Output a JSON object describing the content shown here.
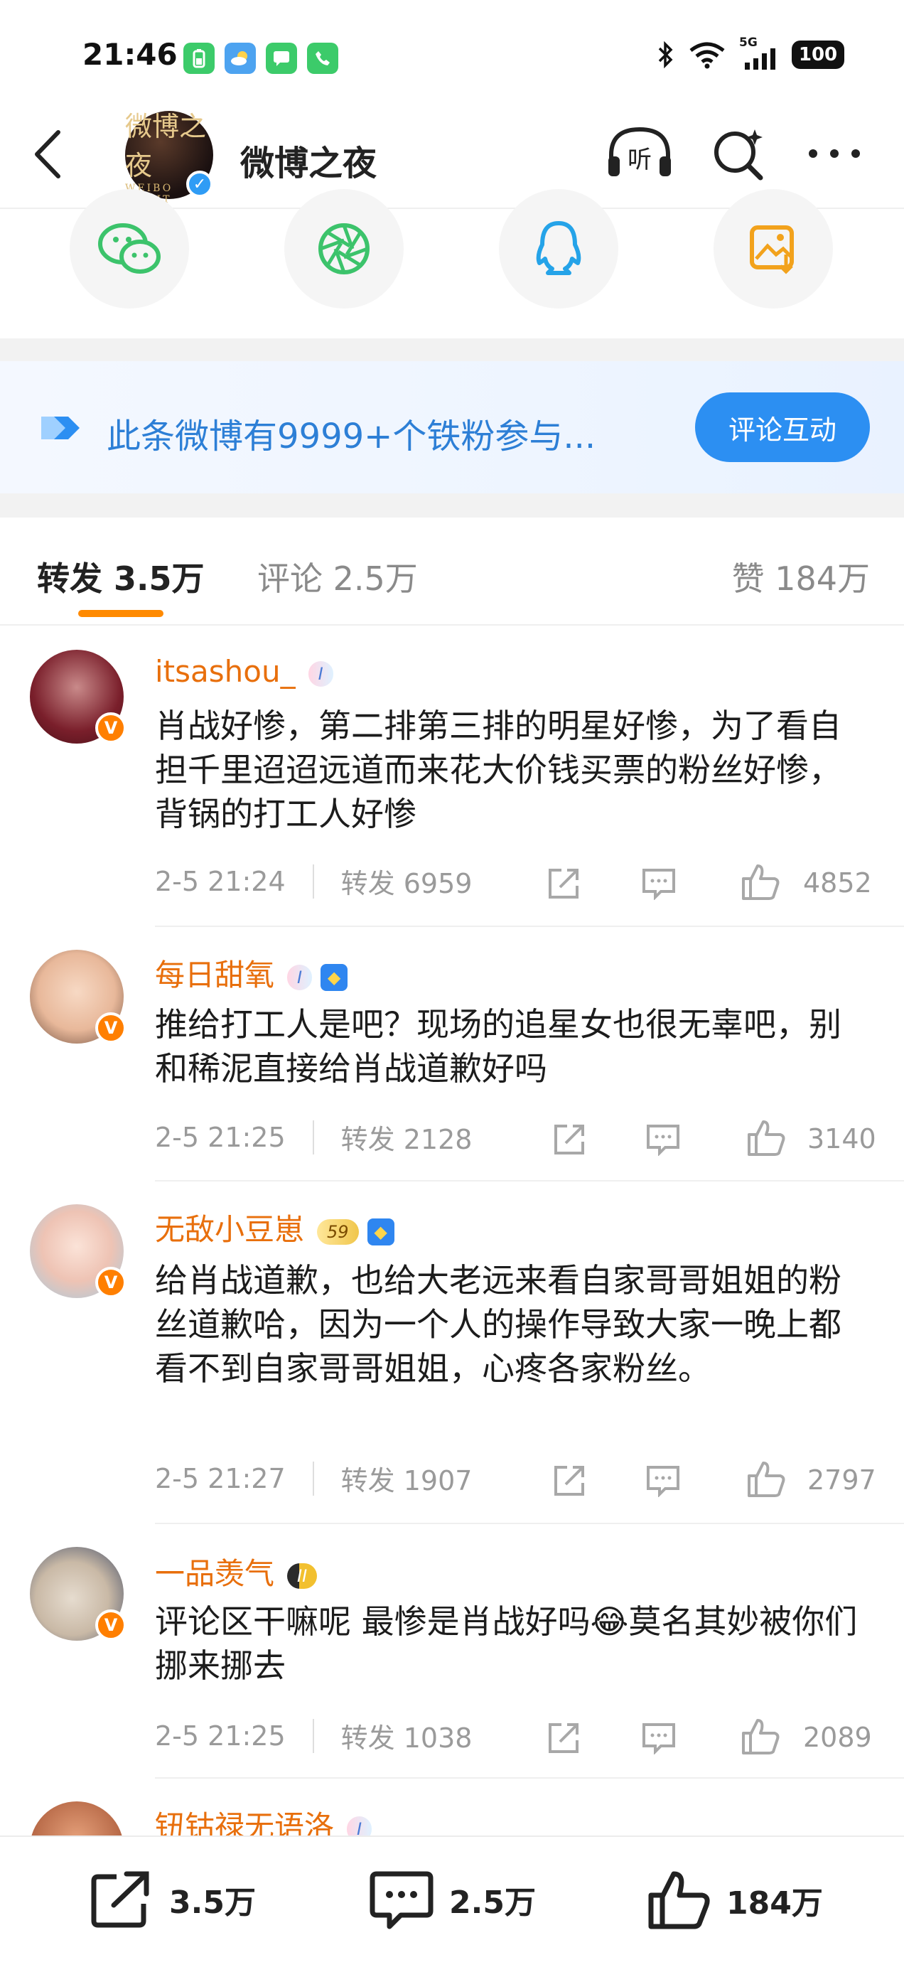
{
  "status": {
    "time": "21:46",
    "battery": "100",
    "network": "5G"
  },
  "header": {
    "title": "微博之夜",
    "avatar_lines": [
      "微博之夜",
      "WEIBO NIGHT"
    ]
  },
  "banner": {
    "text": "此条微博有9999+个铁粉参与...",
    "button": "评论互动"
  },
  "tabs": {
    "repost": "转发 3.5万",
    "comment": "评论 2.5万",
    "like": "赞 184万"
  },
  "comments": [
    {
      "name": "itsashou_",
      "level": "I",
      "text": "肖战好惨，第二排第三排的明星好惨，为了看自担千里迢迢远道而来花大价钱买票的粉丝好惨，背锅的打工人好惨",
      "time": "2-5 21:24",
      "reposts": "转发 6959",
      "likes": "4852"
    },
    {
      "name": "每日甜氧",
      "level": "I",
      "text": "推给打工人是吧？现场的追星女也很无辜吧，别和稀泥直接给肖战道歉好吗",
      "time": "2-5 21:25",
      "reposts": "转发 2128",
      "likes": "3140"
    },
    {
      "name": "无敌小豆崽",
      "level": "59",
      "text": "给肖战道歉，也给大老远来看自家哥哥姐姐的粉丝道歉哈，因为一个人的操作导致大家一晚上都看不到自家哥哥姐姐，心疼各家粉丝。",
      "time": "2-5 21:27",
      "reposts": "转发 1907",
      "likes": "2797"
    },
    {
      "name": "一品羡气",
      "level": "II",
      "text": "评论区干嘛呢 最惨是肖战好吗😂莫名其妙被你们挪来挪去",
      "time": "2-5 21:25",
      "reposts": "转发 1038",
      "likes": "2089"
    },
    {
      "name": "钮钴禄无语洛",
      "level": "I"
    }
  ],
  "bottom": {
    "reposts": "3.5万",
    "comments": "2.5万",
    "likes": "184万"
  },
  "colors": {
    "accent_orange": "#ff8a00",
    "name_orange": "#e86f0c",
    "link_blue": "#2d7fd6",
    "button_blue": "#2c8ff2"
  }
}
